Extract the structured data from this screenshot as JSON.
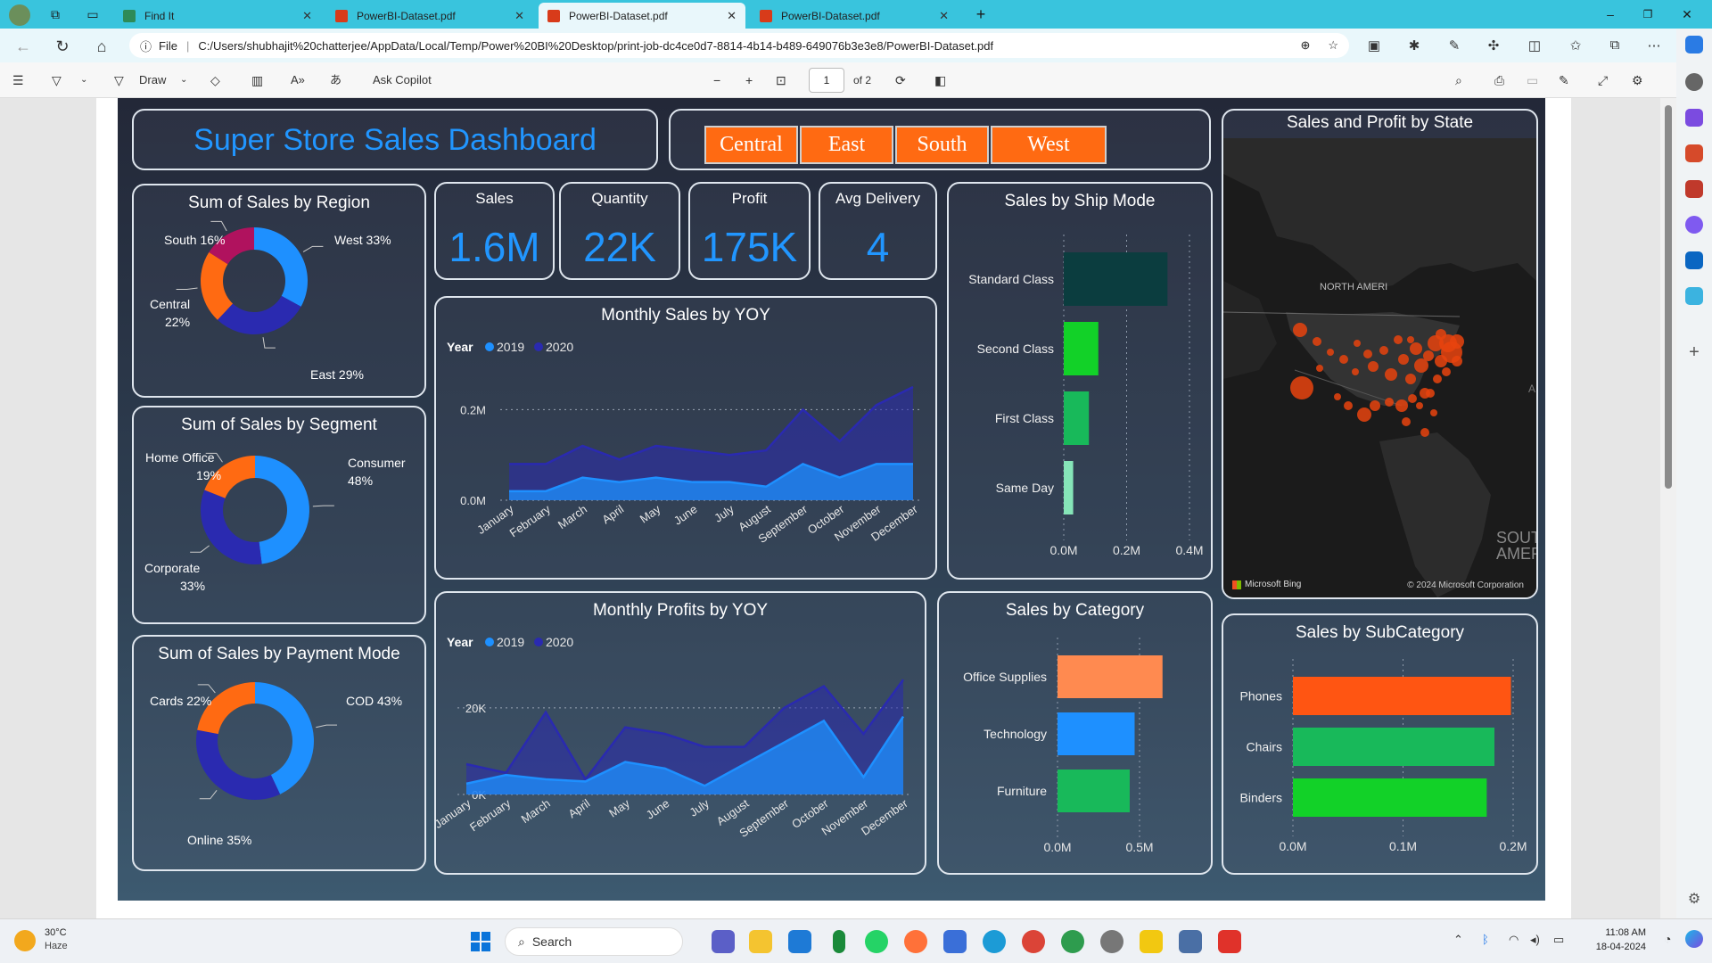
{
  "browser": {
    "tabs": [
      {
        "label": "Find It",
        "active": false,
        "icon_color": "#2e8b57"
      },
      {
        "label": "PowerBI-Dataset.pdf",
        "active": false,
        "icon_color": "#d83b1a"
      },
      {
        "label": "PowerBI-Dataset.pdf",
        "active": true,
        "icon_color": "#d83b1a"
      },
      {
        "label": "PowerBI-Dataset.pdf",
        "active": false,
        "icon_color": "#d83b1a"
      }
    ],
    "file_label": "File",
    "url": "C:/Users/shubhajit%20chatterjee/AppData/Local/Temp/Power%20BI%20Desktop/print-job-dc4ce0d7-8814-4b14-b489-649076b3e3e8/PowerBI-Dataset.pdf"
  },
  "pdf_toolbar": {
    "draw_label": "Draw",
    "copilot_label": "Ask Copilot",
    "page_current": "1",
    "page_total": "of 2"
  },
  "dashboard": {
    "title": "Super Store Sales Dashboard",
    "region_slicer": [
      "Central",
      "East",
      "South",
      "West"
    ],
    "kpis": [
      {
        "label": "Sales",
        "value": "1.6M"
      },
      {
        "label": "Quantity",
        "value": "22K"
      },
      {
        "label": "Profit",
        "value": "175K"
      },
      {
        "label": "Avg Delivery",
        "value": "4"
      }
    ],
    "region_card": {
      "title": "Sum of Sales by Region",
      "labels": [
        "West 33%",
        "East 29%",
        "Central",
        "22%",
        "South 16%"
      ]
    },
    "segment_card": {
      "title": "Sum of Sales by Segment",
      "labels": [
        "Consumer",
        "48%",
        "Corporate",
        "33%",
        "Home Office",
        "19%"
      ]
    },
    "payment_card": {
      "title": "Sum of Sales by Payment Mode",
      "labels": [
        "COD 43%",
        "Online 35%",
        "Cards 22%"
      ]
    },
    "sales_line": {
      "title": "Monthly Sales by YOY",
      "legend_title": "Year"
    },
    "profit_line": {
      "title": "Monthly Profits by YOY",
      "legend_title": "Year"
    },
    "ship_card": {
      "title": "Sales by Ship Mode"
    },
    "category_card": {
      "title": "Sales by Category"
    },
    "subcat_card": {
      "title": "Sales by SubCategory"
    },
    "map": {
      "title": "Sales and Profit by State",
      "region_label": "NORTH AMERI",
      "south_label": "SOUT\nAMERI",
      "bing": "Microsoft Bing",
      "copyright": "© 2024 Microsoft Corporation",
      "edge_letter": "A"
    }
  },
  "chart_data": [
    {
      "type": "pie",
      "title": "Sum of Sales by Region",
      "labels": [
        "West",
        "East",
        "Central",
        "South"
      ],
      "values": [
        33,
        29,
        22,
        16
      ],
      "colors": [
        "#1e90ff",
        "#2a2ab0",
        "#ff6a12",
        "#b0125e"
      ]
    },
    {
      "type": "pie",
      "title": "Sum of Sales by Segment",
      "labels": [
        "Consumer",
        "Corporate",
        "Home Office"
      ],
      "values": [
        48,
        33,
        19
      ],
      "colors": [
        "#1e90ff",
        "#2a2ab0",
        "#ff6a12"
      ]
    },
    {
      "type": "pie",
      "title": "Sum of Sales by Payment Mode",
      "labels": [
        "COD",
        "Online",
        "Cards"
      ],
      "values": [
        43,
        35,
        22
      ],
      "colors": [
        "#1e90ff",
        "#2a2ab0",
        "#ff6a12"
      ]
    },
    {
      "type": "area",
      "title": "Monthly Sales by YOY",
      "categories": [
        "January",
        "February",
        "March",
        "April",
        "May",
        "June",
        "July",
        "August",
        "September",
        "October",
        "November",
        "December"
      ],
      "series": [
        {
          "name": "2019",
          "color": "#1e90ff",
          "values": [
            0.02,
            0.02,
            0.05,
            0.04,
            0.05,
            0.04,
            0.04,
            0.03,
            0.08,
            0.05,
            0.08,
            0.08
          ]
        },
        {
          "name": "2020",
          "color": "#2a2ab0",
          "values": [
            0.08,
            0.08,
            0.12,
            0.09,
            0.12,
            0.11,
            0.1,
            0.11,
            0.2,
            0.13,
            0.21,
            0.25
          ]
        }
      ],
      "yticks": [
        "0.0M",
        "0.2M"
      ],
      "ylim": [
        0,
        0.25
      ]
    },
    {
      "type": "area",
      "title": "Monthly Profits by YOY",
      "categories": [
        "January",
        "February",
        "March",
        "April",
        "May",
        "June",
        "July",
        "August",
        "September",
        "October",
        "November",
        "December"
      ],
      "series": [
        {
          "name": "2019",
          "color": "#1e90ff",
          "values": [
            2500,
            4500,
            3500,
            3000,
            7500,
            6000,
            2000,
            7000,
            12000,
            17000,
            4000,
            18000
          ]
        },
        {
          "name": "2020",
          "color": "#2a2ab0",
          "values": [
            7000,
            5000,
            19000,
            3500,
            15500,
            14000,
            11000,
            11000,
            20000,
            25000,
            14000,
            26500
          ]
        }
      ],
      "yticks": [
        "0K",
        "20K"
      ],
      "ylim": [
        0,
        28000
      ]
    },
    {
      "type": "bar",
      "title": "Sales by Ship Mode",
      "categories": [
        "Standard Class",
        "Second Class",
        "First Class",
        "Same Day"
      ],
      "values": [
        0.33,
        0.11,
        0.08,
        0.03
      ],
      "colors": [
        "#0b3d3f",
        "#12d128",
        "#18b95a",
        "#86e5b8"
      ],
      "xticks": [
        "0.0M",
        "0.2M",
        "0.4M"
      ],
      "xlim": [
        0,
        0.4
      ]
    },
    {
      "type": "bar",
      "title": "Sales by Category",
      "categories": [
        "Office Supplies",
        "Technology",
        "Furniture"
      ],
      "values": [
        0.64,
        0.47,
        0.44
      ],
      "colors": [
        "#ff8a50",
        "#1e90ff",
        "#18b95a"
      ],
      "xticks": [
        "0.0M",
        "0.5M"
      ],
      "xlim": [
        0,
        0.5
      ]
    },
    {
      "type": "bar",
      "title": "Sales by SubCategory",
      "categories": [
        "Phones",
        "Chairs",
        "Binders"
      ],
      "values": [
        0.198,
        0.183,
        0.176
      ],
      "colors": [
        "#ff5512",
        "#18b95a",
        "#12d128"
      ],
      "xticks": [
        "0.0M",
        "0.1M",
        "0.2M"
      ],
      "xlim": [
        0,
        0.2
      ]
    }
  ],
  "taskbar": {
    "weather_temp": "30°C",
    "weather_desc": "Haze",
    "search_label": "Search",
    "time": "11:08 AM",
    "date": "18-04-2024"
  }
}
